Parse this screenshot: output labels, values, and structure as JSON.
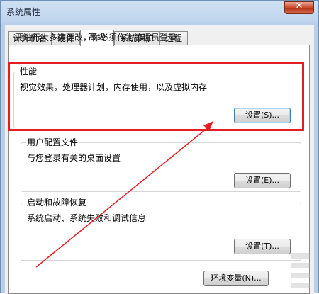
{
  "window": {
    "title": "系统属性",
    "close_glyph": "✕"
  },
  "tabs": [
    {
      "label": "计算机名"
    },
    {
      "label": "硬件"
    },
    {
      "label": "高级"
    },
    {
      "label": "系统保护"
    },
    {
      "label": "远程"
    }
  ],
  "active_tab": "高级",
  "advanced": {
    "admin_note": "要进行大多数更改，你必须作为管理员登录。",
    "performance": {
      "title": "性能",
      "description": "视觉效果，处理器计划，内存使用，以及虚拟内存",
      "button_label": "设置(S)..."
    },
    "user_profiles": {
      "title": "用户配置文件",
      "description": "与您登录有关的桌面设置",
      "button_label": "设置(E)..."
    },
    "startup_recovery": {
      "title": "启动和故障恢复",
      "description": "系统启动、系统失败和调试信息",
      "button_label": "设置(T)..."
    },
    "env_button_label": "环境变量(N)..."
  },
  "annotation": {
    "highlight_color": "#e41d24"
  }
}
